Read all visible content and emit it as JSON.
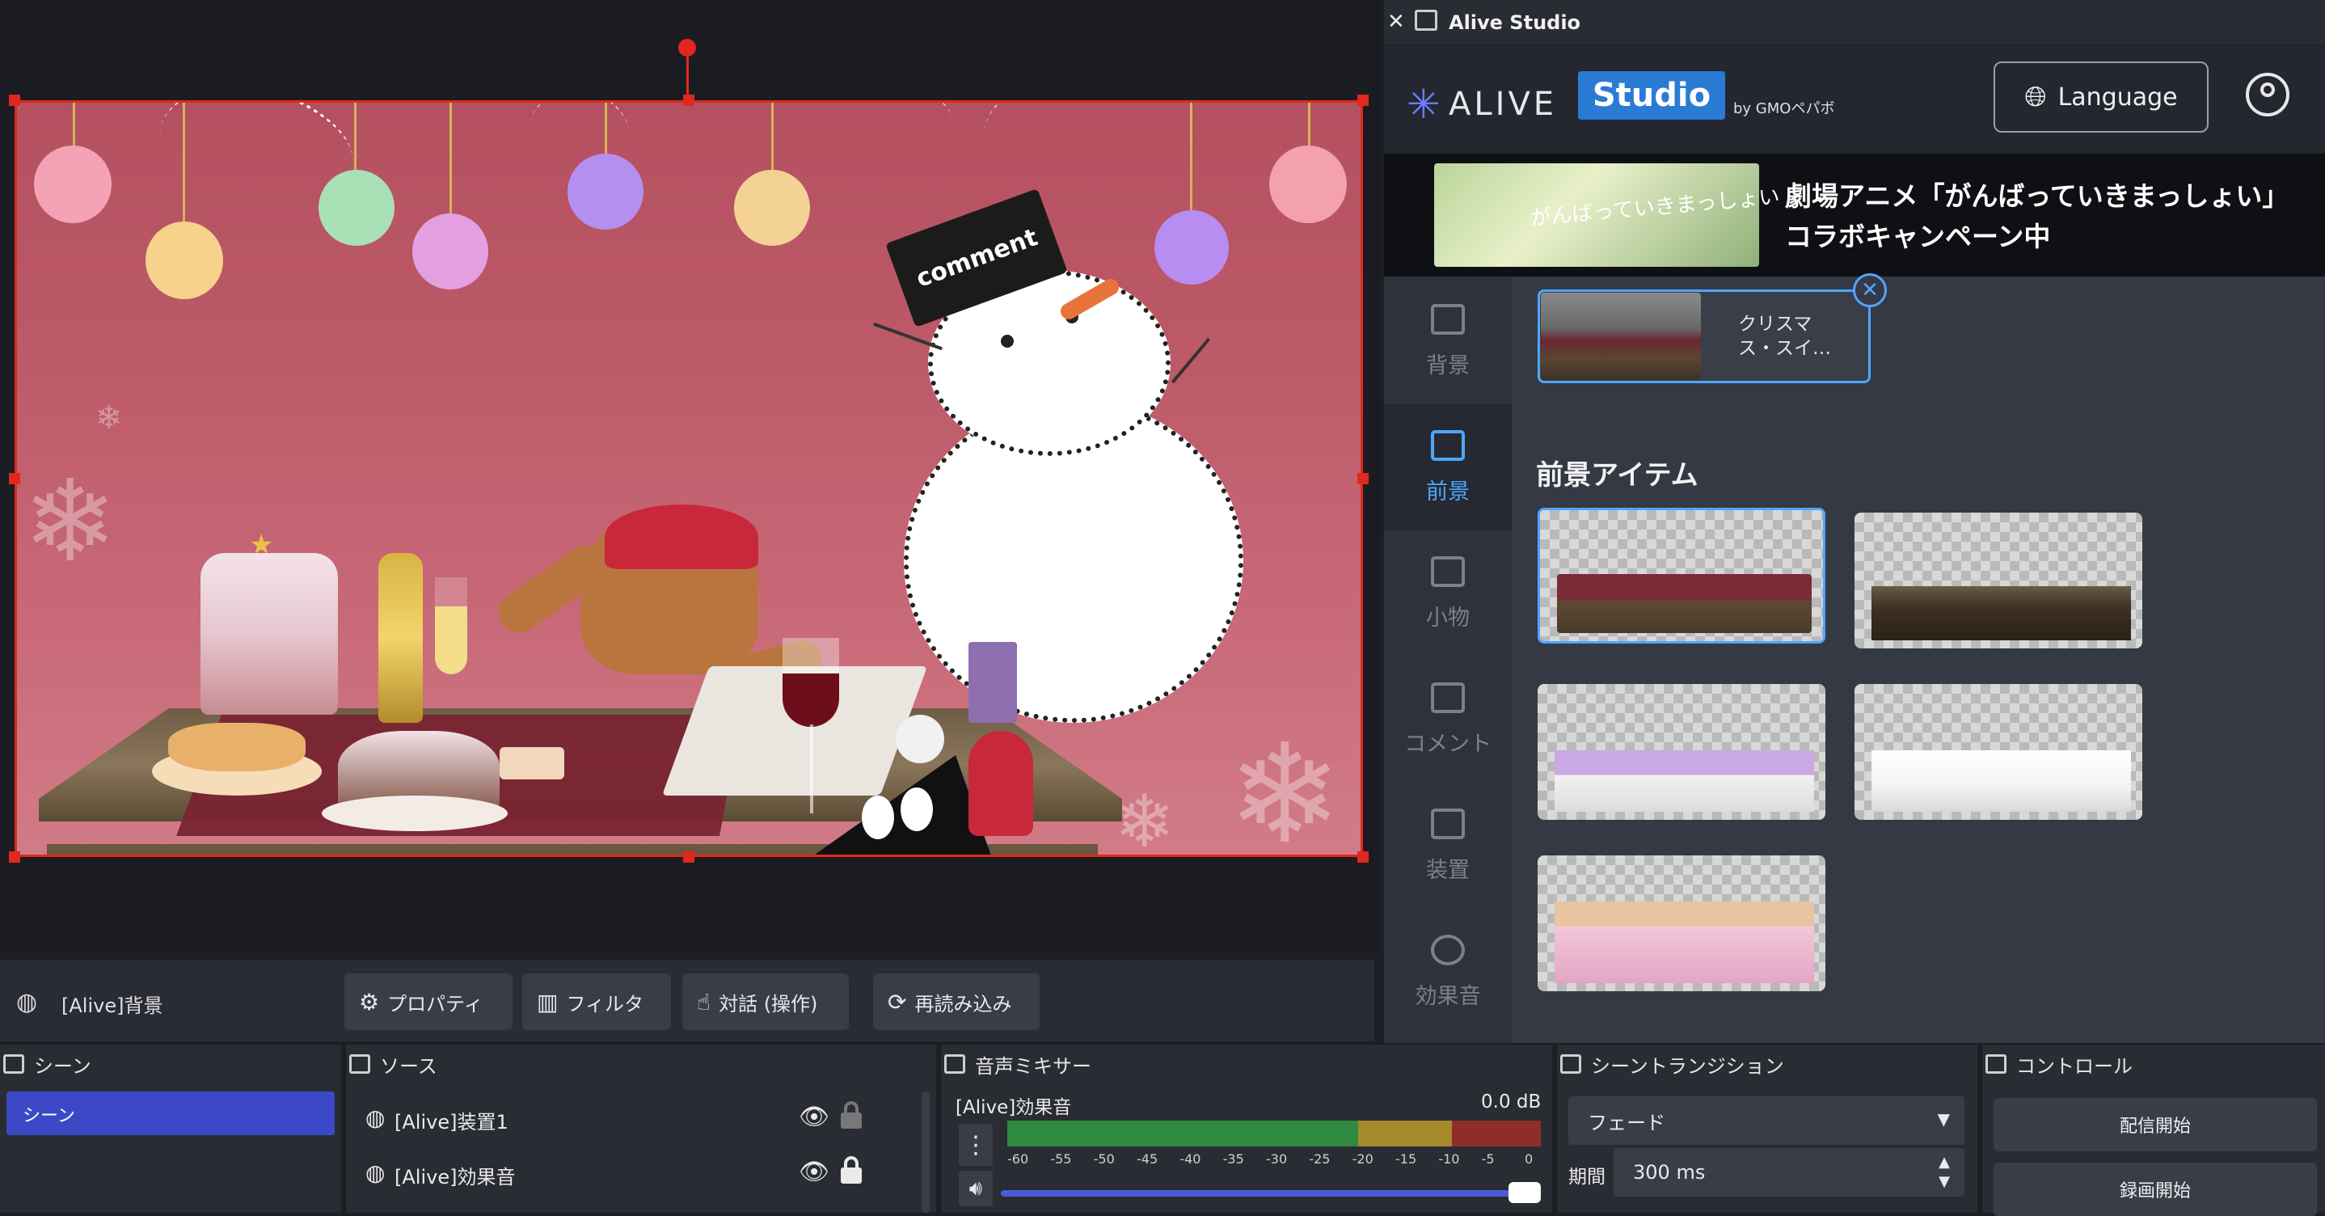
{
  "preview": {
    "selected_source": "[Alive]背景",
    "hat_text": "comment",
    "toolbar": {
      "properties": "プロパティ",
      "filters": "フィルタ",
      "interact": "対話 (操作)",
      "reload": "再読み込み"
    }
  },
  "alive": {
    "window_title": "Alive Studio",
    "logo_alive": "ALIVE",
    "logo_studio": "Studio",
    "logo_by": "by GMOペパボ",
    "language_button": "Language",
    "banner": {
      "image_text": "がんばっていきまっしょい",
      "line1": "劇場アニメ「がんばっていきまっしょい」",
      "line2": "コラボキャンペーン中"
    },
    "nav": [
      {
        "label": "背景",
        "active": false
      },
      {
        "label": "前景",
        "active": true
      },
      {
        "label": "小物",
        "active": false
      },
      {
        "label": "コメント",
        "active": false
      },
      {
        "label": "装置",
        "active": false
      },
      {
        "label": "効果音",
        "active": false
      }
    ],
    "selected_item": {
      "name_line1": "クリスマ",
      "name_line2": "ス・スイ…"
    },
    "foreground_heading": "前景アイテム"
  },
  "docks": {
    "scenes": {
      "title": "シーン",
      "items": [
        "シーン"
      ]
    },
    "sources": {
      "title": "ソース",
      "items": [
        {
          "name": "[Alive]装置1",
          "locked": false
        },
        {
          "name": "[Alive]効果音",
          "locked": true
        }
      ]
    },
    "mixer": {
      "title": "音声ミキサー",
      "channel": "[Alive]効果音",
      "db": "0.0 dB",
      "ticks": [
        "-60",
        "-55",
        "-50",
        "-45",
        "-40",
        "-35",
        "-30",
        "-25",
        "-20",
        "-15",
        "-10",
        "-5",
        "0"
      ],
      "volume_fraction": 1.0
    },
    "transitions": {
      "title": "シーントランジション",
      "selected": "フェード",
      "duration_label": "期間",
      "duration_value": "300 ms"
    },
    "controls": {
      "title": "コントロール",
      "start_stream": "配信開始",
      "start_record": "録画開始"
    }
  },
  "colors": {
    "accent": "#4ea6ff",
    "selection": "#e0281e",
    "scene_selected": "#3c49c6",
    "meter_green": "#2ea043",
    "meter_yellow": "#c9a227",
    "meter_red": "#c0392b"
  }
}
